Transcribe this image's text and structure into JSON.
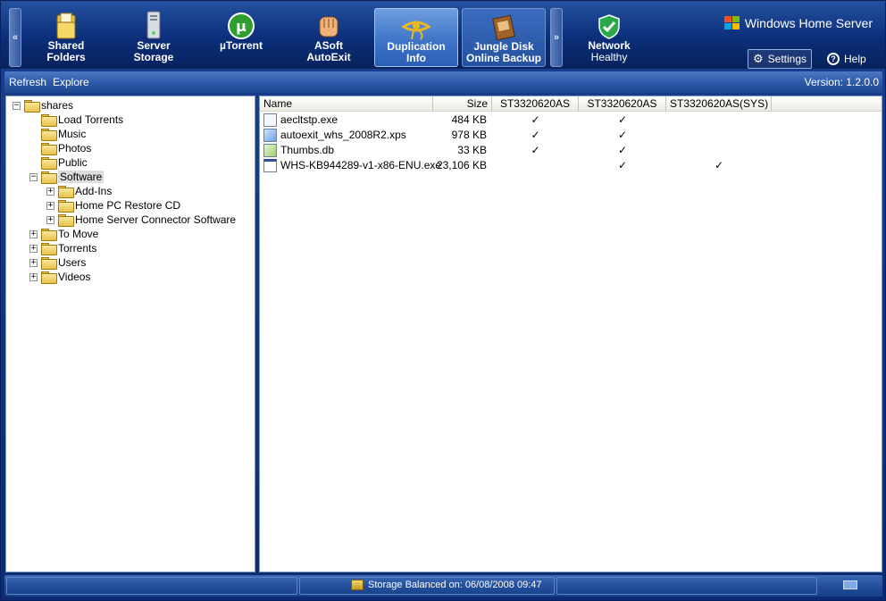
{
  "ribbon": {
    "left_scroll": "«",
    "right_scroll": "»",
    "tabs": [
      {
        "line1": "Shared",
        "line2": "Folders",
        "icon": "folder-icon"
      },
      {
        "line1": "Server",
        "line2": "Storage",
        "icon": "server-icon"
      },
      {
        "line1": "µTorrent",
        "line2": "",
        "icon": "utorrent-icon"
      },
      {
        "line1": "ASoft",
        "line2": "AutoExit",
        "icon": "fist-icon"
      },
      {
        "line1": "Duplication",
        "line2": "Info",
        "icon": "eye-of-horus-icon"
      },
      {
        "line1": "Jungle Disk",
        "line2": "Online Backup",
        "icon": "jungle-disk-icon"
      },
      {
        "line1": "Network",
        "line2": "Healthy",
        "icon": "shield-check-icon"
      }
    ],
    "brand": "Windows Home Server",
    "settings": "Settings",
    "help": "Help"
  },
  "toolbar": {
    "refresh": "Refresh",
    "explore": "Explore",
    "version": "Version: 1.2.0.0"
  },
  "tree": {
    "root": "shares",
    "nodes": [
      {
        "label": "Load Torrents"
      },
      {
        "label": "Music"
      },
      {
        "label": "Photos"
      },
      {
        "label": "Public"
      },
      {
        "label": "Software",
        "selected": true
      },
      {
        "label": "Add-Ins"
      },
      {
        "label": "Home PC Restore CD"
      },
      {
        "label": "Home Server Connector Software"
      },
      {
        "label": "To Move"
      },
      {
        "label": "Torrents"
      },
      {
        "label": "Users"
      },
      {
        "label": "Videos"
      }
    ],
    "expand_sym": "+",
    "collapse_sym": "−"
  },
  "list": {
    "columns": [
      "Name",
      "Size",
      "ST3320620AS",
      "ST3320620AS",
      "ST3320620AS(SYS)"
    ],
    "check": "✓",
    "rows": [
      {
        "name": "aecltstp.exe",
        "size": "484 KB",
        "d1": true,
        "d2": true,
        "d3": false,
        "icon": "exe-icon"
      },
      {
        "name": "autoexit_whs_2008R2.xps",
        "size": "978 KB",
        "d1": true,
        "d2": true,
        "d3": false,
        "icon": "xps-icon"
      },
      {
        "name": "Thumbs.db",
        "size": "33 KB",
        "d1": true,
        "d2": true,
        "d3": false,
        "icon": "db-icon"
      },
      {
        "name": "WHS-KB944289-v1-x86-ENU.exe",
        "size": "23,106 KB",
        "d1": false,
        "d2": true,
        "d3": true,
        "icon": "installer-icon"
      }
    ]
  },
  "status": {
    "message": "Storage Balanced on: 06/08/2008 09:47"
  }
}
